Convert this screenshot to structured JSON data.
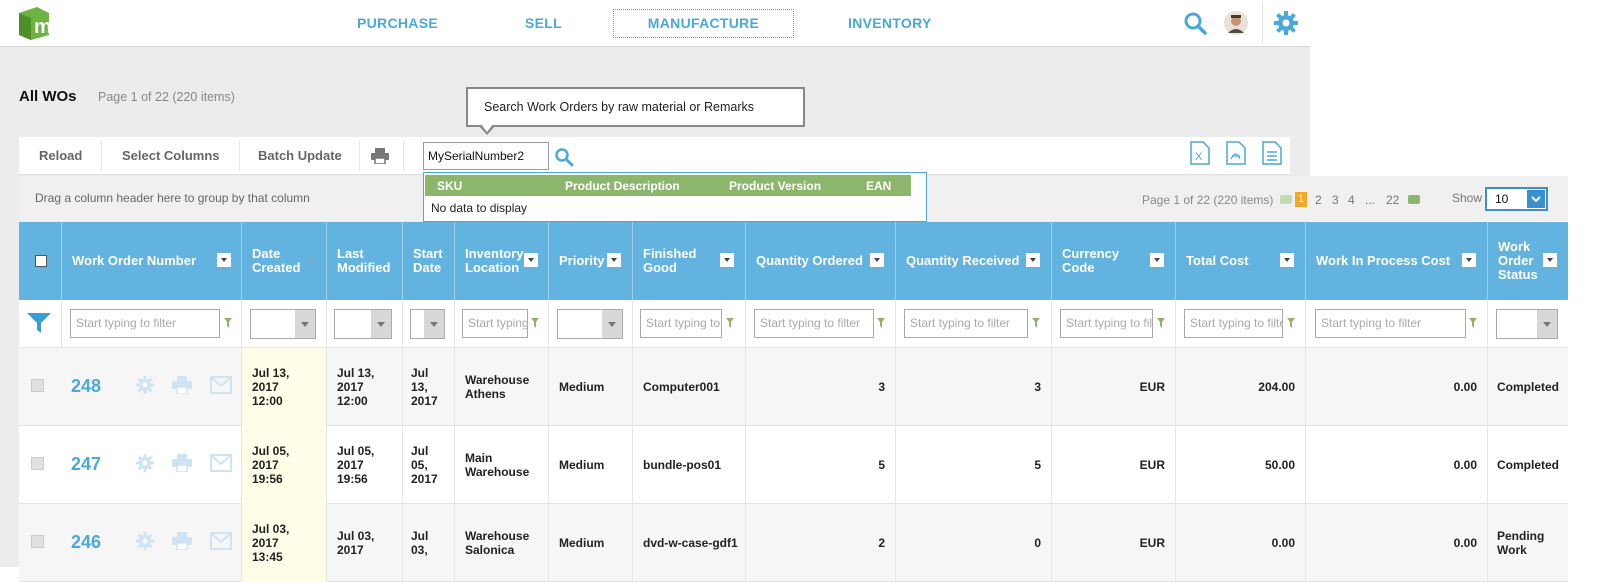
{
  "nav": {
    "purchase": "PURCHASE",
    "sell": "SELL",
    "manufacture": "MANUFACTURE",
    "inventory": "INVENTORY",
    "accent": "#4aa8db"
  },
  "page": {
    "title": "All WOs",
    "info": "Page 1 of 22 (220 items)"
  },
  "tooltip": "Search Work Orders by raw material or Remarks",
  "toolbar": {
    "reload": "Reload",
    "select_columns": "Select Columns",
    "batch_update": "Batch Update",
    "search_value": "MySerialNumber2"
  },
  "dropdown": {
    "headers": [
      "SKU",
      "Product Description",
      "Product Version",
      "EAN"
    ],
    "empty": "No data to display"
  },
  "grouping": {
    "hint": "Drag a column header here to group by that column",
    "pager_info": "Page 1 of 22 (220 items)",
    "pages": [
      "1",
      "2",
      "3",
      "4",
      "...",
      "22"
    ],
    "show_label": "Show",
    "show_value": "10"
  },
  "columns": {
    "wo_number": "Work Order Number",
    "date_created": "Date Created",
    "last_modified": "Last Modified",
    "start_date": "Start Date",
    "inventory_location": "Inventory Location",
    "priority": "Priority",
    "finished_good": "Finished Good",
    "qty_ordered": "Quantity Ordered",
    "qty_received": "Quantity Received",
    "currency": "Currency Code",
    "total_cost": "Total Cost",
    "wip_cost": "Work In Process Cost",
    "status": "Work Order Status"
  },
  "filter_placeholder": "Start typing to filter",
  "rows": [
    {
      "number": "248",
      "date_created": "Jul 13, 2017 12:00",
      "last_modified": "Jul 13, 2017 12:00",
      "start_date": "Jul 13, 2017",
      "location": "Warehouse Athens",
      "priority": "Medium",
      "finished_good": "Computer001",
      "qty_ordered": "3",
      "qty_received": "3",
      "currency": "EUR",
      "total_cost": "204.00",
      "wip_cost": "0.00",
      "status": "Completed"
    },
    {
      "number": "247",
      "date_created": "Jul 05, 2017 19:56",
      "last_modified": "Jul 05, 2017 19:56",
      "start_date": "Jul 05, 2017",
      "location": "Main Warehouse",
      "priority": "Medium",
      "finished_good": "bundle-pos01",
      "qty_ordered": "5",
      "qty_received": "5",
      "currency": "EUR",
      "total_cost": "50.00",
      "wip_cost": "0.00",
      "status": "Completed"
    },
    {
      "number": "246",
      "date_created": "Jul 03, 2017 13:45",
      "last_modified": "Jul 03, 2017",
      "start_date": "Jul 03,",
      "location": "Warehouse Salonica",
      "priority": "Medium",
      "finished_good": "dvd-w-case-gdf1",
      "qty_ordered": "2",
      "qty_received": "0",
      "currency": "EUR",
      "total_cost": "0.00",
      "wip_cost": "0.00",
      "status": "Pending Work"
    }
  ]
}
